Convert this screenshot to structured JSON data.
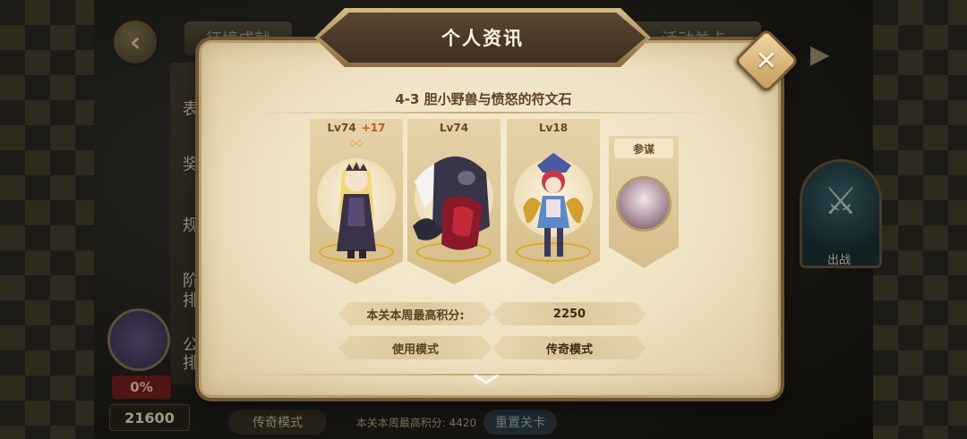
{
  "background": {
    "tab_left": "征境成就",
    "tab_right": "活动关卡",
    "side_labels": [
      "表",
      "奖",
      "规",
      "阶",
      "排",
      "公",
      "排"
    ],
    "emblem_percent": "0%",
    "left_score": "21600",
    "fight_label": "出战",
    "bottom_mode": "传奇模式",
    "bottom_score": "本关本周最高积分: 4420",
    "bottom_reset": "重置关卡"
  },
  "dialog": {
    "title": "个人资讯",
    "stage_title": "4-3 胆小野兽与愤怒的符文石",
    "heroes": [
      {
        "level": "Lv74",
        "bonus": "+17",
        "stars": "◇◇"
      },
      {
        "level": "Lv74",
        "bonus": "",
        "stars": ""
      },
      {
        "level": "Lv18",
        "bonus": "",
        "stars": ""
      }
    ],
    "adviser_label": "参谋",
    "score_label": "本关本周最高积分:",
    "score_value": "2250",
    "mode_label": "使用模式",
    "mode_value": "传奇模式"
  },
  "icons": {
    "close": "close-icon",
    "back": "back-arrow-icon",
    "expand": "chevron-down-icon",
    "fight": "crossed-swords-icon"
  },
  "colors": {
    "parchment": "#efe2c2",
    "frame": "#6b5536",
    "title_plaque": "#4a3a28",
    "text_brown": "#5a4224",
    "bonus": "#c0582a"
  }
}
